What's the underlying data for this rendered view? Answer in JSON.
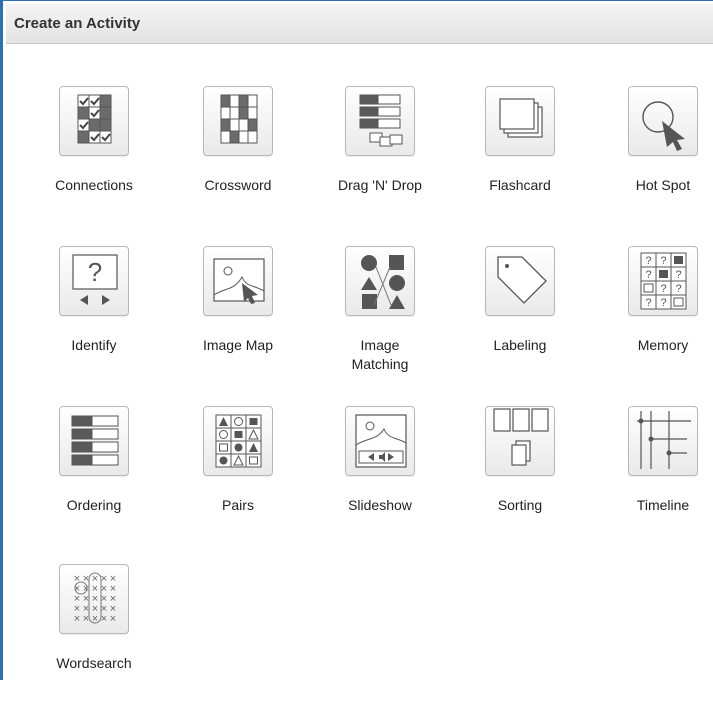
{
  "panel": {
    "title": "Create an Activity"
  },
  "activities": [
    {
      "label": "Connections",
      "icon": "connections-icon"
    },
    {
      "label": "Crossword",
      "icon": "crossword-icon"
    },
    {
      "label": "Drag 'N' Drop",
      "icon": "drag-n-drop-icon"
    },
    {
      "label": "Flashcard",
      "icon": "flashcard-icon"
    },
    {
      "label": "Hot Spot",
      "icon": "hot-spot-icon"
    },
    {
      "label": "Identify",
      "icon": "identify-icon"
    },
    {
      "label": "Image Map",
      "icon": "image-map-icon"
    },
    {
      "label": "Image Matching",
      "icon": "image-matching-icon"
    },
    {
      "label": "Labeling",
      "icon": "labeling-icon"
    },
    {
      "label": "Memory",
      "icon": "memory-icon"
    },
    {
      "label": "Ordering",
      "icon": "ordering-icon"
    },
    {
      "label": "Pairs",
      "icon": "pairs-icon"
    },
    {
      "label": "Slideshow",
      "icon": "slideshow-icon"
    },
    {
      "label": "Sorting",
      "icon": "sorting-icon"
    },
    {
      "label": "Timeline",
      "icon": "timeline-icon"
    },
    {
      "label": "Wordsearch",
      "icon": "wordsearch-icon"
    }
  ]
}
